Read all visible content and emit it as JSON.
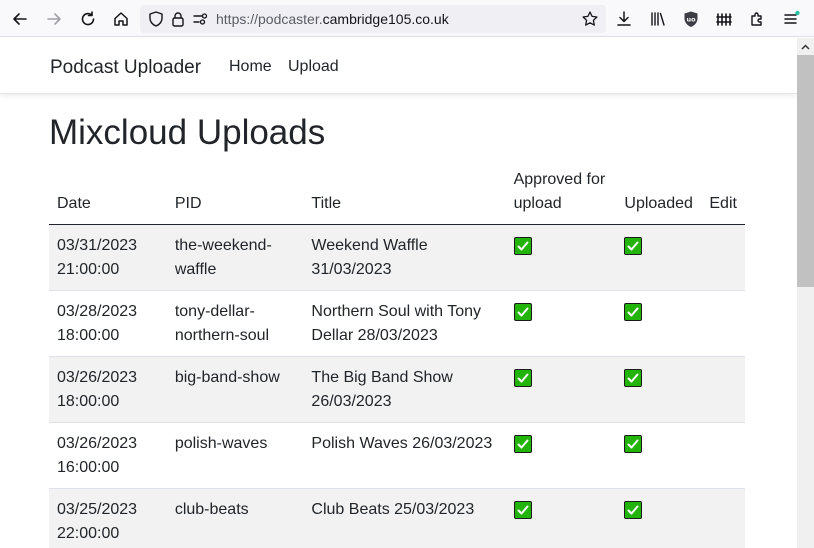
{
  "browser": {
    "url_prefix": "https://podcaster.",
    "url_host": "cambridge105.co.uk"
  },
  "navbar": {
    "brand": "Podcast Uploader",
    "links": [
      "Home",
      "Upload"
    ]
  },
  "page_title": "Mixcloud Uploads",
  "table": {
    "headers": [
      "Date",
      "PID",
      "Title",
      "Approved for upload",
      "Uploaded",
      "Edit"
    ],
    "rows": [
      {
        "date": "03/31/2023 21:00:00",
        "pid": "the-weekend-waffle",
        "title": "Weekend Waffle 31/03/2023",
        "approved": true,
        "uploaded": true
      },
      {
        "date": "03/28/2023 18:00:00",
        "pid": "tony-dellar-northern-soul",
        "title": "Northern Soul with Tony Dellar 28/03/2023",
        "approved": true,
        "uploaded": true
      },
      {
        "date": "03/26/2023 18:00:00",
        "pid": "big-band-show",
        "title": "The Big Band Show 26/03/2023",
        "approved": true,
        "uploaded": true
      },
      {
        "date": "03/26/2023 16:00:00",
        "pid": "polish-waves",
        "title": "Polish Waves 26/03/2023",
        "approved": true,
        "uploaded": true
      },
      {
        "date": "03/25/2023 22:00:00",
        "pid": "club-beats",
        "title": "Club Beats 25/03/2023",
        "approved": true,
        "uploaded": true
      }
    ]
  },
  "colors": {
    "check_green": "#23b40c"
  }
}
